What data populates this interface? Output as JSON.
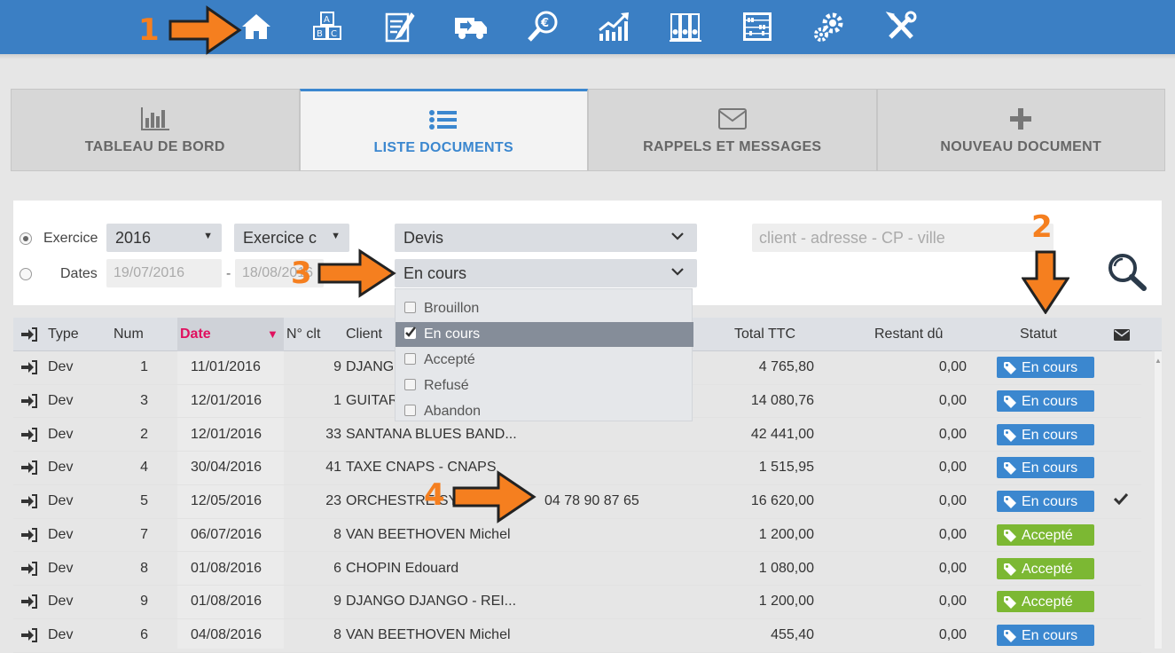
{
  "nav": {
    "icons": [
      "home-icon",
      "alphabet-blocks-icon",
      "edit-document-icon",
      "delivery-truck-icon",
      "euro-search-icon",
      "growth-chart-icon",
      "binders-icon",
      "abacus-icon",
      "gears-icon",
      "tools-icon"
    ]
  },
  "tabs": [
    {
      "label": "TABLEAU DE BORD",
      "icon": "bar-chart-icon"
    },
    {
      "label": "LISTE DOCUMENTS",
      "icon": "list-icon"
    },
    {
      "label": "RAPPELS ET MESSAGES",
      "icon": "envelope-icon"
    },
    {
      "label": "NOUVEAU DOCUMENT",
      "icon": "plus-icon"
    }
  ],
  "filters": {
    "exercice_label": "Exercice",
    "dates_label": "Dates",
    "year_value": "2016",
    "exercice_select_value": "Exercice c",
    "doc_type_value": "Devis",
    "status_value": "En cours",
    "date_from": "19/07/2016",
    "date_sep": "-",
    "date_to": "18/08/2016",
    "search_placeholder": "client - adresse - CP - ville"
  },
  "dropdown": {
    "options": [
      {
        "label": "Brouillon",
        "checked": false
      },
      {
        "label": "En cours",
        "checked": true
      },
      {
        "label": "Accepté",
        "checked": false
      },
      {
        "label": "Refusé",
        "checked": false
      },
      {
        "label": "Abandon",
        "checked": false
      }
    ]
  },
  "table": {
    "headers": {
      "type": "Type",
      "num": "Num",
      "date": "Date",
      "nclt": "N° clt",
      "client": "Client",
      "total": "Total TTC",
      "restant": "Restant dû",
      "statut": "Statut"
    },
    "rows": [
      {
        "type": "Dev",
        "num": "1",
        "date": "11/01/2016",
        "nclt": "9",
        "client": "DJANGO",
        "phone": "",
        "total": "4 765,80",
        "restant": "0,00",
        "statut": "En cours",
        "sent": false
      },
      {
        "type": "Dev",
        "num": "3",
        "date": "12/01/2016",
        "nclt": "1",
        "client": "GUITAR",
        "phone": "",
        "total": "14 080,76",
        "restant": "0,00",
        "statut": "En cours",
        "sent": false
      },
      {
        "type": "Dev",
        "num": "2",
        "date": "12/01/2016",
        "nclt": "33",
        "client": "SANTANA BLUES BAND...",
        "phone": "",
        "total": "42 441,00",
        "restant": "0,00",
        "statut": "En cours",
        "sent": false
      },
      {
        "type": "Dev",
        "num": "4",
        "date": "30/04/2016",
        "nclt": "41",
        "client": "TAXE CNAPS - CNAPS",
        "phone": "",
        "total": "1 515,95",
        "restant": "0,00",
        "statut": "En cours",
        "sent": false
      },
      {
        "type": "Dev",
        "num": "5",
        "date": "12/05/2016",
        "nclt": "23",
        "client": "ORCHESTRE SYM",
        "phone": "04 78 90 87 65",
        "total": "16 620,00",
        "restant": "0,00",
        "statut": "En cours",
        "sent": true
      },
      {
        "type": "Dev",
        "num": "7",
        "date": "06/07/2016",
        "nclt": "8",
        "client": "VAN BEETHOVEN Michel",
        "phone": "",
        "total": "1 200,00",
        "restant": "0,00",
        "statut": "Accepté",
        "sent": false
      },
      {
        "type": "Dev",
        "num": "8",
        "date": "01/08/2016",
        "nclt": "6",
        "client": "CHOPIN Edouard",
        "phone": "",
        "total": "1 080,00",
        "restant": "0,00",
        "statut": "Accepté",
        "sent": false
      },
      {
        "type": "Dev",
        "num": "9",
        "date": "01/08/2016",
        "nclt": "9",
        "client": "DJANGO DJANGO - REI...",
        "phone": "",
        "total": "1 200,00",
        "restant": "0,00",
        "statut": "Accepté",
        "sent": false
      },
      {
        "type": "Dev",
        "num": "6",
        "date": "04/08/2016",
        "nclt": "8",
        "client": "VAN BEETHOVEN Michel",
        "phone": "",
        "total": "455,40",
        "restant": "0,00",
        "statut": "En cours",
        "sent": false
      }
    ]
  },
  "status_colors": {
    "En cours": "#3b87cf",
    "Accepté": "#7cb833"
  },
  "annotations": [
    "1",
    "2",
    "3",
    "4"
  ],
  "colors": {
    "nav_bg": "#3b7fc4",
    "accent": "#3b87cf",
    "annotation": "#f57f1f",
    "sort_arrow": "#e0115f"
  }
}
